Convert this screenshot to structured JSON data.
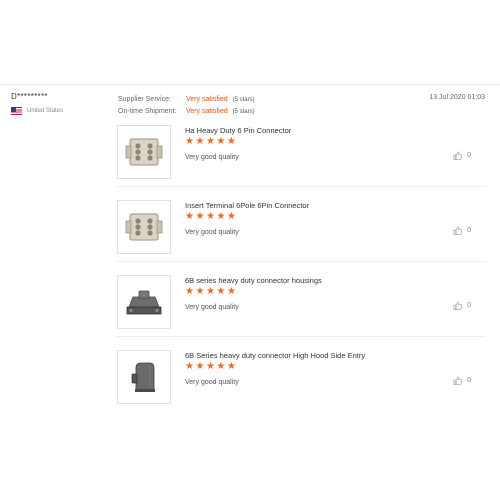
{
  "reviewer": {
    "name": "D*********",
    "country": "United States",
    "flag_icon": "us-flag-icon"
  },
  "ratings": [
    {
      "label": "Supplier Service:",
      "value": "Very satisfied",
      "stars_text": "(5 stars)"
    },
    {
      "label": "On-time Shipment:",
      "value": "Very satisfied",
      "stars_text": "(5 stars)"
    }
  ],
  "date": "13 Jul 2020 01:03",
  "products": [
    {
      "name": "Ha Heavy Duty 6 Pin Connector",
      "rating": 5,
      "comment": "Very good quality",
      "likes": "0",
      "image_icon": "connector-insert-icon"
    },
    {
      "name": "Insert Terminal 6Pole 6Pin Connector",
      "rating": 5,
      "comment": "Very good quality",
      "likes": "0",
      "image_icon": "connector-insert-icon"
    },
    {
      "name": "6B series heavy duty connector housings",
      "rating": 5,
      "comment": "Very good quality",
      "likes": "0",
      "image_icon": "connector-housing-icon"
    },
    {
      "name": "6B Series heavy duty connector High Hood Side Entry",
      "rating": 5,
      "comment": "Very good quality",
      "likes": "0",
      "image_icon": "connector-hood-icon"
    }
  ],
  "colors": {
    "accent": "#f26b1d",
    "rating_text": "#e8590c"
  }
}
